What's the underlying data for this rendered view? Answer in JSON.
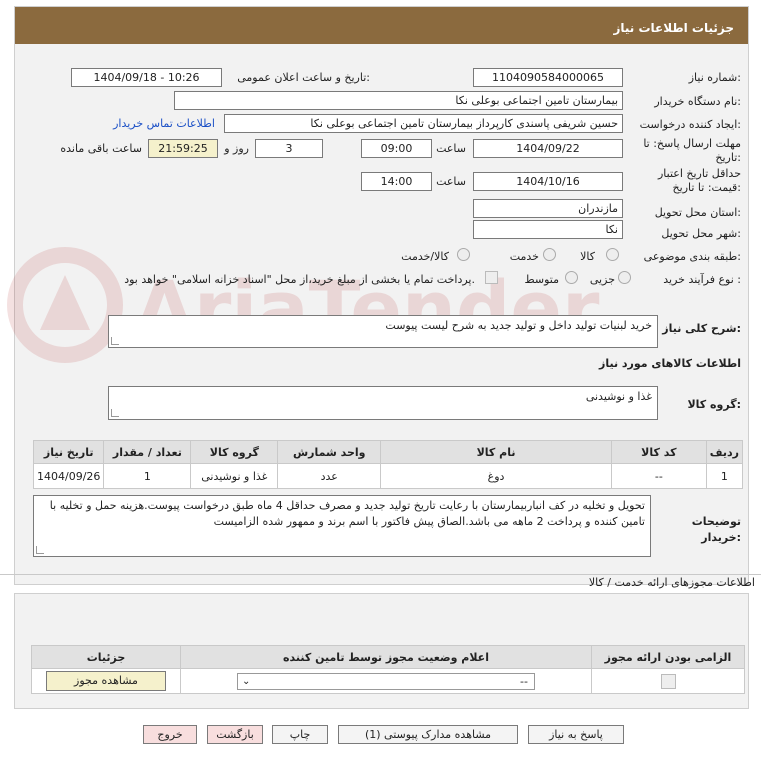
{
  "header": {
    "title": "جزئیات اطلاعات نیاز"
  },
  "form": {
    "need_number_label": "شماره نیاز:",
    "need_number": "1104090584000065",
    "announce_label": "تاریخ و ساعت اعلان عمومی:",
    "announce_value": "1404/09/18 - 10:26",
    "buyer_org_label": "نام دستگاه خریدار:",
    "buyer_org": "بیمارستان تامین اجتماعی بوعلی نکا",
    "requester_label": "ایجاد کننده درخواست:",
    "requester": "حسین شریفی پاسندی کارپرداز بیمارستان تامین اجتماعی بوعلی نکا",
    "contact_link": "اطلاعات تماس خریدار",
    "deadline_label": "مهلت ارسال پاسخ: تا تاریخ:",
    "deadline_date": "1404/09/22",
    "deadline_time_label": "ساعت",
    "deadline_time": "09:00",
    "days_label": "روز و",
    "days": "3",
    "remaining_time": "21:59:25",
    "remaining_label": "ساعت باقی مانده",
    "validity_label": "حداقل تاریخ اعتبار قیمت: تا تاریخ:",
    "validity_date": "1404/10/16",
    "validity_time_label": "ساعت",
    "validity_time": "14:00",
    "province_label": "استان محل تحویل:",
    "province": "مازندران",
    "city_label": "شهر محل تحویل:",
    "city": "نکا",
    "category_label": "طبقه بندی موضوعی:",
    "category_options": [
      "کالا",
      "خدمت",
      "کالا/خدمت"
    ],
    "purchase_type_label": "نوع فرآیند خرید :",
    "purchase_options": [
      "جزیی",
      "متوسط"
    ],
    "payment_note": "پرداخت تمام یا بخشی از مبلغ خرید،از محل \"اسناد خزانه اسلامی\" خواهد بود.",
    "description_label": "شرح کلی نیاز:",
    "description": "خرید لبنیات تولید داخل و تولید جدید به شرح لیست پیوست",
    "goods_info_title": "اطلاعات کالاهای مورد نیاز",
    "goods_group_label": "گروه کالا:",
    "goods_group": "غذا و نوشیدنی"
  },
  "goods_table": {
    "headers": [
      "ردیف",
      "کد کالا",
      "نام کالا",
      "واحد شمارش",
      "گروه کالا",
      "تعداد / مقدار",
      "تاریخ نیاز"
    ],
    "rows": [
      [
        "1",
        "--",
        "دوغ",
        "عدد",
        "غذا و نوشیدنی",
        "1",
        "1404/09/26"
      ]
    ]
  },
  "buyer_notes_label": "توضیحات خریدار:",
  "buyer_notes": "تحویل و تخلیه در کف انباربیمارستان با رعایت  تاریخ تولید جدید و مصرف حداقل 4 ماه طبق درخواست پیوست.هزینه حمل و تخلیه با تامین کننده و پرداخت 2 ماهه می باشد.الصاق پیش فاکتور با اسم برند و  ممهور شده الزامیست",
  "permits": {
    "title": "اطلاعات مجوزهای ارائه خدمت / کالا",
    "headers": [
      "الزامی بودن ارائه مجوز",
      "اعلام وضعیت مجوز توسط تامین کننده",
      "جزئیات"
    ],
    "status_value": "--",
    "view_button": "مشاهده مجوز"
  },
  "buttons": {
    "reply": "پاسخ به نیاز",
    "attachments": "مشاهده مدارک پیوستی (1)",
    "print": "چاپ",
    "back": "بازگشت",
    "exit": "خروج"
  },
  "watermark_text": "AriaTender.net",
  "colors": {
    "header_bg": "#8b6a3e",
    "link": "#1a4fc6",
    "remaining_bg": "#f5f1cc",
    "danger_btn": "#f8dede"
  }
}
